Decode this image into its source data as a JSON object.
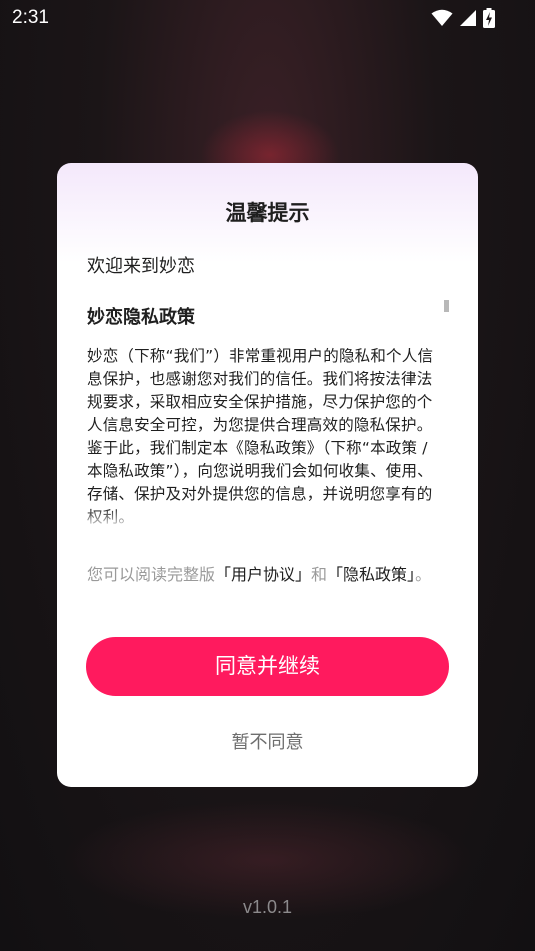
{
  "status_bar": {
    "time": "2:31",
    "icons": [
      "wifi-icon",
      "signal-icon",
      "battery-charging-icon"
    ]
  },
  "dialog": {
    "title": "温馨提示",
    "welcome": "欢迎来到妙恋",
    "policy_heading": "妙恋隐私政策",
    "policy_body": "妙恋（下称“我们”）非常重视用户的隐私和个人信息保护，也感谢您对我们的信任。我们将按法律法规要求，采取相应安全保护措施，尽力保护您的个人信息安全可控，为您提供合理高效的隐私保护。鉴于此，我们制定本《隐私政策》（下称“本政策 / 本隐私政策”），向您说明我们会如何收集、使用、存储、保护及对外提供您的信息，并说明您享有的权利。",
    "read_note_prefix": "您可以阅读完整版",
    "user_agreement_link": "「用户协议」",
    "read_note_and": "和",
    "privacy_policy_link": "「隐私政策」",
    "read_note_suffix": "。",
    "agree_label": "同意并继续",
    "decline_label": "暂不同意"
  },
  "version": "v1.0.1",
  "colors": {
    "accent": "#ff1a5e",
    "dialog_top": "#f4e8fb",
    "muted_text": "#9a9a9a"
  }
}
